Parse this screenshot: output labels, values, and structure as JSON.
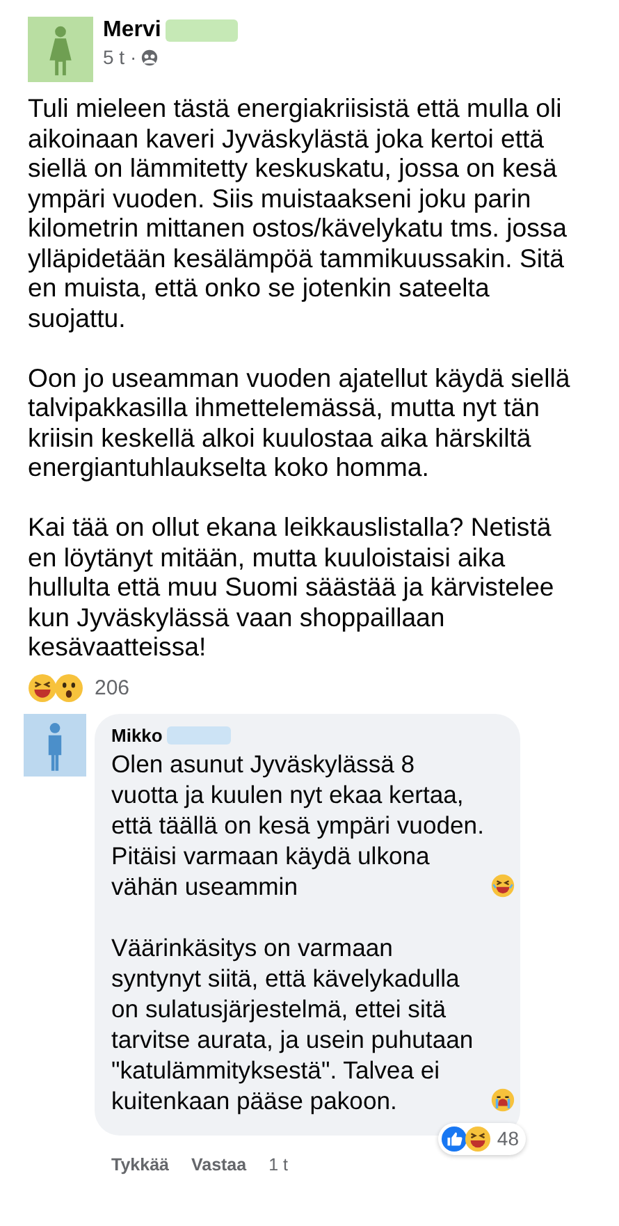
{
  "post": {
    "author": "Mervi",
    "time": "5 t ·",
    "paragraphs": [
      {
        "text": "Tuli mieleen tästä energiakriisistä että mulla oli aikoinaan kaveri Jyväskylästä joka kertoi että siellä on lämmitetty keskuskatu, jossa on kesä ympäri vuoden. Siis muistaakseni joku parin kilometrin mittanen ostos/kävelykatu tms. jossa ylläpidetään kesälämpöä tammikuussakin. Sitä en muista, että onko se jotenkin sateelta suojattu."
      },
      {
        "text": "Oon jo useamman vuoden ajatellut käydä siellä talvipakkasilla ihmettelemässä, mutta nyt tän kriisin keskellä alkoi kuulostaa aika härskiltä energiantuhlaukselta koko homma."
      },
      {
        "text": "Kai tää on ollut ekana leikkauslistalla? Netistä en löytänyt mitään, mutta kuuloistaisi aika hullulta että muu Suomi säästää ja kärvistelee kun Jyväskylässä vaan shoppaillaan kesävaatteissa!"
      }
    ],
    "reactions": {
      "types": [
        {
          "kind": "laughing"
        },
        {
          "kind": "surprised"
        }
      ],
      "count": "206"
    }
  },
  "comment": {
    "author": "Mikko",
    "paragraphs": [
      {
        "text": "Olen asunut Jyväskylässä 8 vuotta ja kuulen nyt ekaa kertaa, että täällä on kesä ympäri vuoden. Pitäisi varmaan käydä ulkona vähän useammin",
        "emoji": {
          "kind": "laughing"
        }
      },
      {
        "text": "Väärinkäsitys on varmaan syntynyt siitä, että kävelykadulla on sulatusjärjestelmä, ettei sitä tarvitse aurata, ja usein puhutaan \"katulämmityksestä\". Talvea ei kuitenkaan pääse pakoon.",
        "emoji": {
          "kind": "crying"
        }
      }
    ],
    "actions": [
      "Tykkää",
      "Vastaa"
    ],
    "time": "1 t",
    "reactions": {
      "types": [
        {
          "kind": "like"
        },
        {
          "kind": "laughing"
        }
      ],
      "count": "48"
    }
  }
}
